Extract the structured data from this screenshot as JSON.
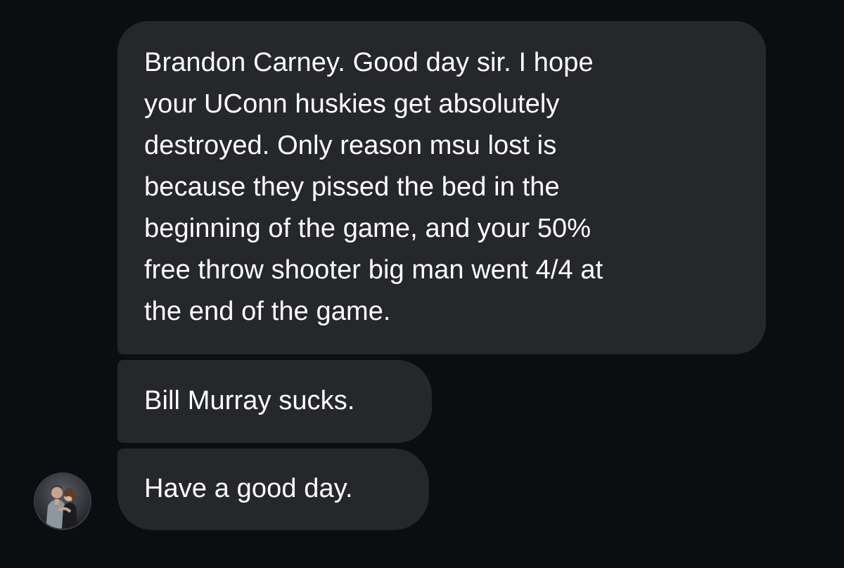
{
  "conversation": {
    "messages": [
      {
        "text": "Brandon Carney. Good day sir. I hope\nyour UConn huskies get absolutely\ndestroyed. Only reason msu lost is\nbecause they pissed the bed in the\nbeginning of the game, and your 50%\nfree throw shooter big man went 4/4 at\nthe end of the game."
      },
      {
        "text": "Bill Murray sucks."
      },
      {
        "text": "Have a good day."
      }
    ],
    "sender_avatar": {
      "icon": "profile-photo-icon"
    }
  },
  "colors": {
    "background": "#0c0d11",
    "bubble": "#26272b",
    "text": "#ffffff"
  }
}
